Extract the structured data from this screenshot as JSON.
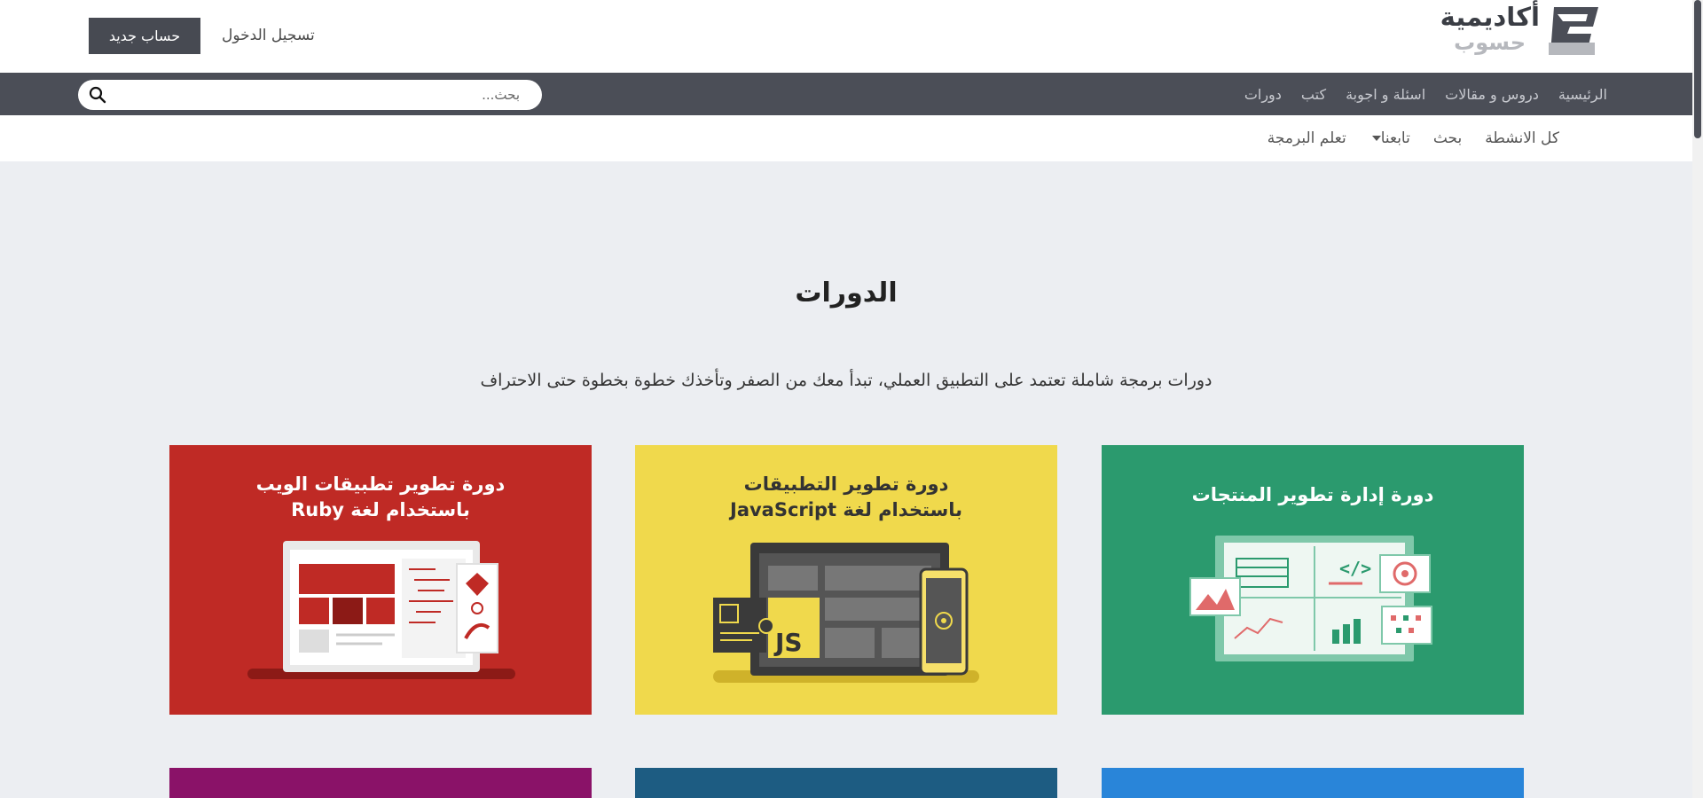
{
  "header": {
    "logo_line1": "أكاديمية",
    "logo_line2": "حسوب",
    "new_account": "حساب جديد",
    "login": "تسجيل الدخول"
  },
  "nav": {
    "items": [
      "الرئيسية",
      "دروس و مقالات",
      "اسئلة و اجوبة",
      "كتب",
      "دورات"
    ],
    "search_placeholder": "بحث..."
  },
  "subnav": {
    "items": [
      "كل الانشطة",
      "بحث",
      "تابعنا",
      "تعلم البرمجة"
    ]
  },
  "main": {
    "title": "الدورات",
    "description": "دورات برمجة شاملة تعتمد على التطبيق العملي، تبدأ معك من الصفر وتأخذك خطوة بخطوة حتى الاحتراف"
  },
  "courses": [
    {
      "title_line1": "دورة إدارة تطوير المنتجات",
      "title_line2": "",
      "color": "#2b9a6e"
    },
    {
      "title_line1": "دورة تطوير التطبيقات",
      "title_line2": "باستخدام لغة JavaScript",
      "color": "#f0d94c",
      "badge": "JS"
    },
    {
      "title_line1": "دورة تطوير تطبيقات الويب",
      "title_line2": "باستخدام لغة Ruby",
      "color": "#bf2a25"
    }
  ],
  "colors": {
    "dark_nav": "#4b4e57",
    "card_purple": "#8a1268",
    "card_teal": "#1d5c82",
    "card_blue": "#2985d9"
  }
}
